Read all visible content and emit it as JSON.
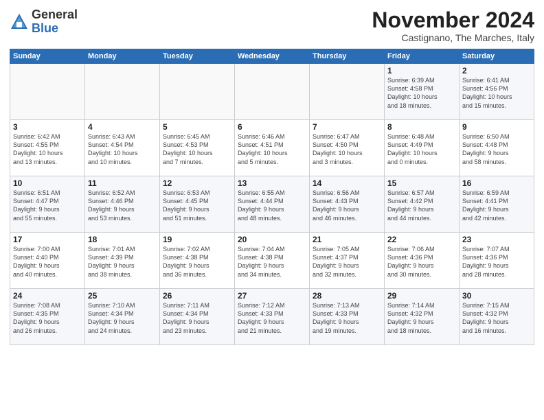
{
  "logo": {
    "general": "General",
    "blue": "Blue"
  },
  "title": "November 2024",
  "subtitle": "Castignano, The Marches, Italy",
  "headers": [
    "Sunday",
    "Monday",
    "Tuesday",
    "Wednesday",
    "Thursday",
    "Friday",
    "Saturday"
  ],
  "weeks": [
    [
      {
        "day": "",
        "info": ""
      },
      {
        "day": "",
        "info": ""
      },
      {
        "day": "",
        "info": ""
      },
      {
        "day": "",
        "info": ""
      },
      {
        "day": "",
        "info": ""
      },
      {
        "day": "1",
        "info": "Sunrise: 6:39 AM\nSunset: 4:58 PM\nDaylight: 10 hours\nand 18 minutes."
      },
      {
        "day": "2",
        "info": "Sunrise: 6:41 AM\nSunset: 4:56 PM\nDaylight: 10 hours\nand 15 minutes."
      }
    ],
    [
      {
        "day": "3",
        "info": "Sunrise: 6:42 AM\nSunset: 4:55 PM\nDaylight: 10 hours\nand 13 minutes."
      },
      {
        "day": "4",
        "info": "Sunrise: 6:43 AM\nSunset: 4:54 PM\nDaylight: 10 hours\nand 10 minutes."
      },
      {
        "day": "5",
        "info": "Sunrise: 6:45 AM\nSunset: 4:53 PM\nDaylight: 10 hours\nand 7 minutes."
      },
      {
        "day": "6",
        "info": "Sunrise: 6:46 AM\nSunset: 4:51 PM\nDaylight: 10 hours\nand 5 minutes."
      },
      {
        "day": "7",
        "info": "Sunrise: 6:47 AM\nSunset: 4:50 PM\nDaylight: 10 hours\nand 3 minutes."
      },
      {
        "day": "8",
        "info": "Sunrise: 6:48 AM\nSunset: 4:49 PM\nDaylight: 10 hours\nand 0 minutes."
      },
      {
        "day": "9",
        "info": "Sunrise: 6:50 AM\nSunset: 4:48 PM\nDaylight: 9 hours\nand 58 minutes."
      }
    ],
    [
      {
        "day": "10",
        "info": "Sunrise: 6:51 AM\nSunset: 4:47 PM\nDaylight: 9 hours\nand 55 minutes."
      },
      {
        "day": "11",
        "info": "Sunrise: 6:52 AM\nSunset: 4:46 PM\nDaylight: 9 hours\nand 53 minutes."
      },
      {
        "day": "12",
        "info": "Sunrise: 6:53 AM\nSunset: 4:45 PM\nDaylight: 9 hours\nand 51 minutes."
      },
      {
        "day": "13",
        "info": "Sunrise: 6:55 AM\nSunset: 4:44 PM\nDaylight: 9 hours\nand 48 minutes."
      },
      {
        "day": "14",
        "info": "Sunrise: 6:56 AM\nSunset: 4:43 PM\nDaylight: 9 hours\nand 46 minutes."
      },
      {
        "day": "15",
        "info": "Sunrise: 6:57 AM\nSunset: 4:42 PM\nDaylight: 9 hours\nand 44 minutes."
      },
      {
        "day": "16",
        "info": "Sunrise: 6:59 AM\nSunset: 4:41 PM\nDaylight: 9 hours\nand 42 minutes."
      }
    ],
    [
      {
        "day": "17",
        "info": "Sunrise: 7:00 AM\nSunset: 4:40 PM\nDaylight: 9 hours\nand 40 minutes."
      },
      {
        "day": "18",
        "info": "Sunrise: 7:01 AM\nSunset: 4:39 PM\nDaylight: 9 hours\nand 38 minutes."
      },
      {
        "day": "19",
        "info": "Sunrise: 7:02 AM\nSunset: 4:38 PM\nDaylight: 9 hours\nand 36 minutes."
      },
      {
        "day": "20",
        "info": "Sunrise: 7:04 AM\nSunset: 4:38 PM\nDaylight: 9 hours\nand 34 minutes."
      },
      {
        "day": "21",
        "info": "Sunrise: 7:05 AM\nSunset: 4:37 PM\nDaylight: 9 hours\nand 32 minutes."
      },
      {
        "day": "22",
        "info": "Sunrise: 7:06 AM\nSunset: 4:36 PM\nDaylight: 9 hours\nand 30 minutes."
      },
      {
        "day": "23",
        "info": "Sunrise: 7:07 AM\nSunset: 4:36 PM\nDaylight: 9 hours\nand 28 minutes."
      }
    ],
    [
      {
        "day": "24",
        "info": "Sunrise: 7:08 AM\nSunset: 4:35 PM\nDaylight: 9 hours\nand 26 minutes."
      },
      {
        "day": "25",
        "info": "Sunrise: 7:10 AM\nSunset: 4:34 PM\nDaylight: 9 hours\nand 24 minutes."
      },
      {
        "day": "26",
        "info": "Sunrise: 7:11 AM\nSunset: 4:34 PM\nDaylight: 9 hours\nand 23 minutes."
      },
      {
        "day": "27",
        "info": "Sunrise: 7:12 AM\nSunset: 4:33 PM\nDaylight: 9 hours\nand 21 minutes."
      },
      {
        "day": "28",
        "info": "Sunrise: 7:13 AM\nSunset: 4:33 PM\nDaylight: 9 hours\nand 19 minutes."
      },
      {
        "day": "29",
        "info": "Sunrise: 7:14 AM\nSunset: 4:32 PM\nDaylight: 9 hours\nand 18 minutes."
      },
      {
        "day": "30",
        "info": "Sunrise: 7:15 AM\nSunset: 4:32 PM\nDaylight: 9 hours\nand 16 minutes."
      }
    ]
  ]
}
